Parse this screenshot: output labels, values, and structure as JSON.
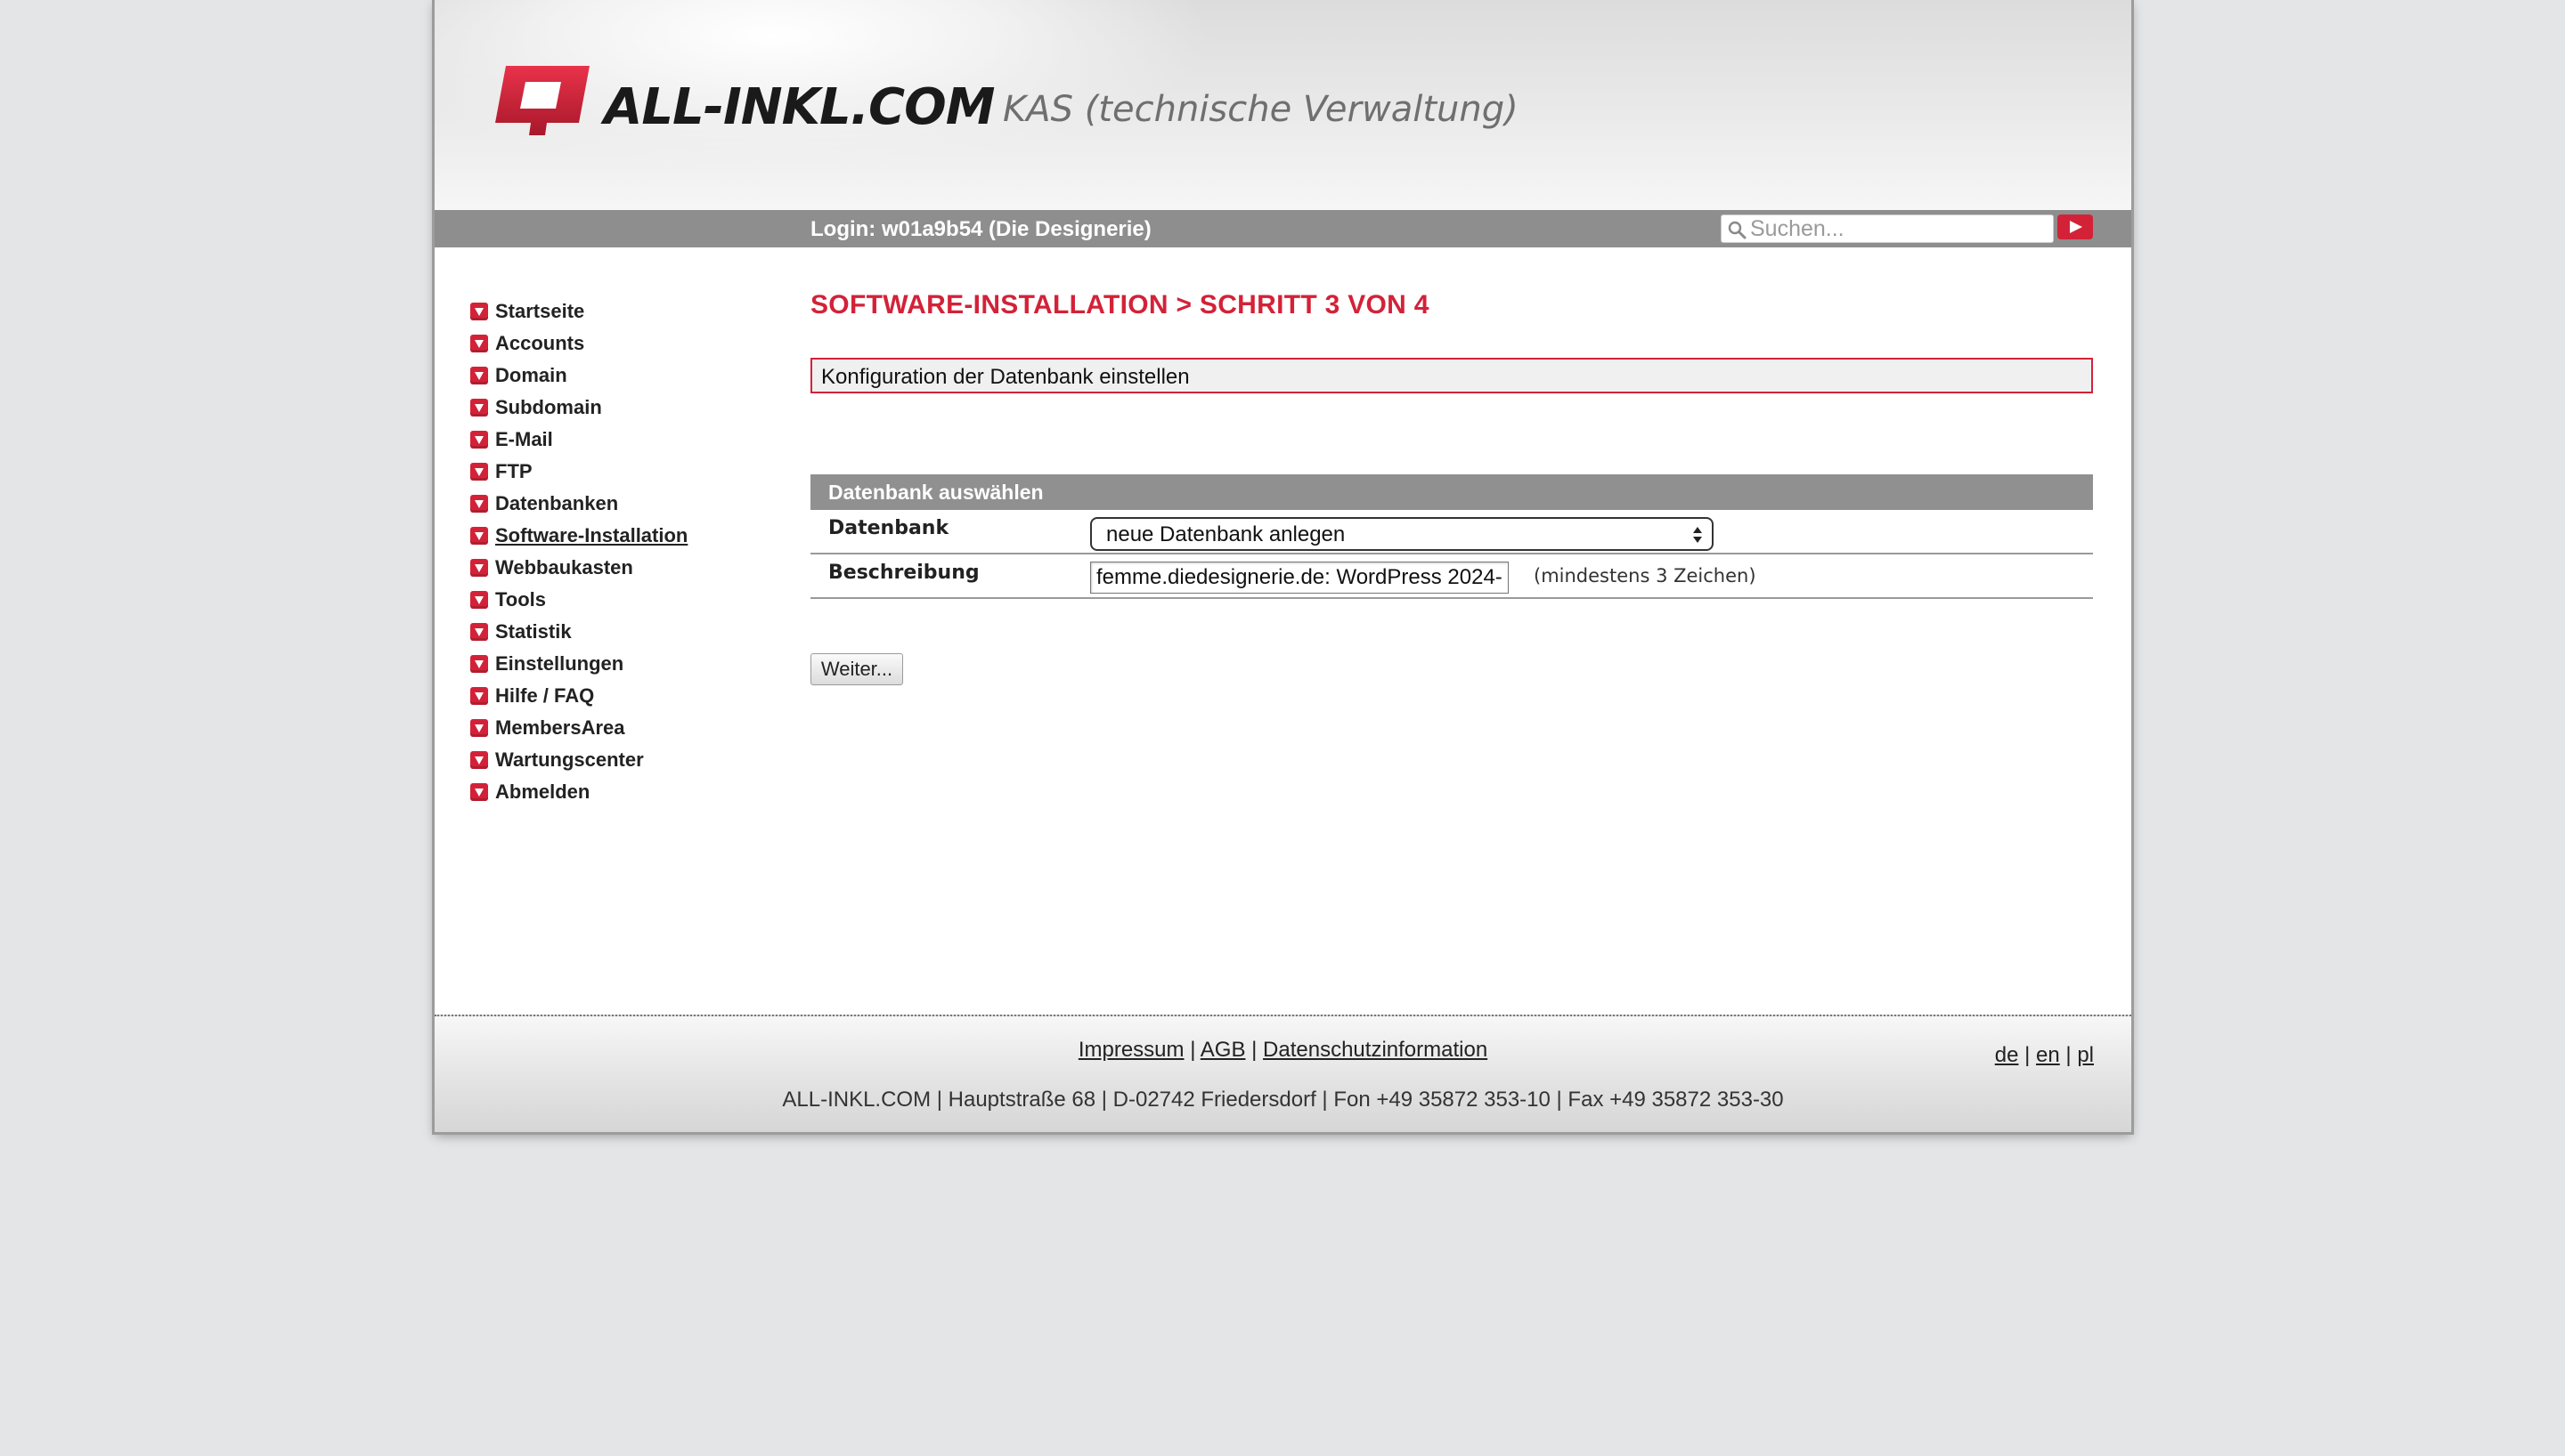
{
  "header": {
    "logo_text": "ALL-INKL.COM",
    "subtitle": "KAS (technische Verwaltung)"
  },
  "topbar": {
    "login": "Login: w01a9b54 (Die Designerie)",
    "search_placeholder": "Suchen..."
  },
  "sidebar": {
    "items": [
      {
        "label": "Startseite"
      },
      {
        "label": "Accounts"
      },
      {
        "label": "Domain"
      },
      {
        "label": "Subdomain"
      },
      {
        "label": "E-Mail"
      },
      {
        "label": "FTP"
      },
      {
        "label": "Datenbanken"
      },
      {
        "label": "Software-Installation",
        "active": true
      },
      {
        "label": "Webbaukasten"
      },
      {
        "label": "Tools"
      },
      {
        "label": "Statistik"
      },
      {
        "label": "Einstellungen"
      },
      {
        "label": "Hilfe / FAQ"
      },
      {
        "label": "MembersArea"
      },
      {
        "label": "Wartungscenter"
      },
      {
        "label": "Abmelden"
      }
    ]
  },
  "main": {
    "title": "SOFTWARE-INSTALLATION > SCHRITT 3 VON 4",
    "info": "Konfiguration der Datenbank einstellen",
    "section_title": "Datenbank auswählen",
    "db_label": "Datenbank",
    "db_selected": "neue Datenbank anlegen",
    "desc_label": "Beschreibung",
    "desc_value": "femme.diedesignerie.de: WordPress 2024-",
    "desc_hint": "(mindestens 3 Zeichen)",
    "next_button": "Weiter..."
  },
  "footer": {
    "links": [
      "Impressum",
      "AGB",
      "Datenschutzinformation"
    ],
    "address": "ALL-INKL.COM | Hauptstraße 68 | D-02742 Friedersdorf | Fon +49 35872 353-10 | Fax +49 35872 353-30",
    "languages": [
      "de",
      "en",
      "pl"
    ]
  },
  "colors": {
    "accent": "#d32238",
    "bar_gray": "#8e8e8e",
    "page_bg": "#e4e5e7"
  }
}
